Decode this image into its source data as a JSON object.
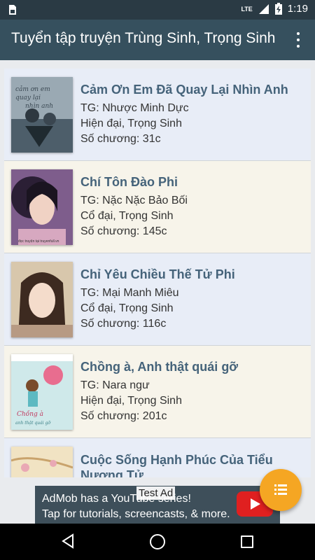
{
  "status_bar": {
    "network": "LTE",
    "time": "1:19"
  },
  "app_bar": {
    "title": "Tuyển tập truyện Trùng Sinh, Trọng Sinh"
  },
  "books": [
    {
      "title": "Cảm Ơn Em Đã Quay Lại Nhìn Anh",
      "author": "TG: Nhược Minh Dực",
      "genre": "Hiện đại, Trọng Sinh",
      "chapters": "Số chương: 31c",
      "cover_text": "cảm ơn em đã quay lại nhìn anh",
      "cover_colors": [
        "#9aa9b3",
        "#4d5e6a"
      ]
    },
    {
      "title": "Chí Tôn Đào Phi",
      "author": "TG: Nặc Nặc Bảo Bối",
      "genre": "Cổ đại, Trọng Sinh",
      "chapters": "Số chương: 145c",
      "cover_text": "đọc truyện tại truyenfull.vn",
      "cover_colors": [
        "#7e5d8c",
        "#2b1f35"
      ]
    },
    {
      "title": "Chỉ Yêu Chiều Thế Tử Phi",
      "author": "TG: Mại Manh Miêu",
      "genre": "Cổ đại, Trọng Sinh",
      "chapters": "Số chương: 116c",
      "cover_text": "",
      "cover_colors": [
        "#d8c7ac",
        "#9b7a5a"
      ]
    },
    {
      "title": "Chồng à, Anh thật quái gỡ",
      "author": "TG: Nara ngư",
      "genre": "Hiện đại, Trọng Sinh",
      "chapters": "Số chương: 201c",
      "cover_text": "Chồng à anh thật quái gỡ",
      "cover_colors": [
        "#cfe9ea",
        "#5db9c1"
      ]
    },
    {
      "title": "Cuộc Sống Hạnh Phúc Của Tiểu Nương Tử",
      "author": "",
      "genre": "",
      "chapters": "",
      "cover_text": "",
      "cover_colors": [
        "#f1e3c3",
        "#c9a36c"
      ]
    }
  ],
  "ad": {
    "line1": "AdMob has a YouTube series!",
    "line2": "Tap for tutorials, screencasts, & more.",
    "label": "Test Ad"
  },
  "icons": [
    "sim-card-icon",
    "lte-signal-icon",
    "battery-charging-icon",
    "more-vert-icon",
    "list-icon",
    "back-icon",
    "home-icon",
    "recents-icon"
  ],
  "colors": {
    "status_bar": "#2a3a44",
    "app_bar": "#36505e",
    "title_text": "#45637a",
    "fab": "#f5a623",
    "row_blue": "#e8edf7",
    "row_cream": "#f7f4ea"
  }
}
